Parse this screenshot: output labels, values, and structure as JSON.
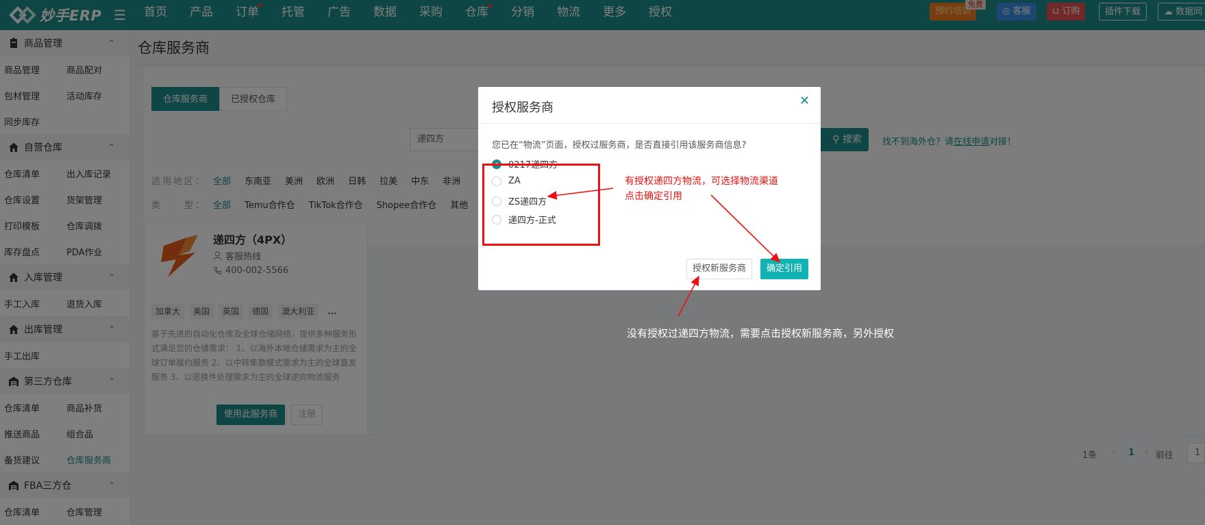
{
  "header": {
    "logo_text": "妙手ERP",
    "nav": [
      {
        "label": "首页",
        "dot": false
      },
      {
        "label": "产品",
        "dot": false
      },
      {
        "label": "订单",
        "dot": true
      },
      {
        "label": "托管",
        "dot": false
      },
      {
        "label": "广告",
        "dot": false
      },
      {
        "label": "数据",
        "dot": false
      },
      {
        "label": "采购",
        "dot": false
      },
      {
        "label": "仓库",
        "dot": true
      },
      {
        "label": "分销",
        "dot": false
      },
      {
        "label": "物流",
        "dot": false
      },
      {
        "label": "更多",
        "dot": false
      },
      {
        "label": "授权",
        "dot": false
      }
    ],
    "training_label": "预约培训",
    "free_badge": "免费",
    "service_label": "客服",
    "order_label": "订购",
    "plugin_label": "插件下载",
    "data_label": "数据同"
  },
  "sidebar": {
    "groups": [
      {
        "title": "商品管理",
        "icon": "clipboard-icon",
        "rows": [
          [
            "商品管理",
            "商品配对"
          ],
          [
            "包材管理",
            "活动库存"
          ],
          [
            "同步库存",
            ""
          ]
        ]
      },
      {
        "title": "自营仓库",
        "icon": "house-icon",
        "rows": [
          [
            "仓库清单",
            "出入库记录"
          ],
          [
            "仓库设置",
            "货架管理"
          ],
          [
            "打印模板",
            "仓库调拨"
          ],
          [
            "库存盘点",
            "PDA作业"
          ]
        ]
      },
      {
        "title": "入库管理",
        "icon": "house-icon",
        "rows": [
          [
            "手工入库",
            "退货入库"
          ]
        ]
      },
      {
        "title": "出库管理",
        "icon": "house-icon",
        "rows": [
          [
            "手工出库",
            ""
          ]
        ]
      },
      {
        "title": "第三方仓库",
        "icon": "warehouse-icon",
        "rows": [
          [
            "仓库清单",
            "商品补货"
          ],
          [
            "推送商品",
            "组合品"
          ],
          [
            "备货建议",
            "仓库服务商"
          ]
        ]
      },
      {
        "title": "FBA三方仓",
        "icon": "warehouse-icon",
        "rows": [
          [
            "仓库清单",
            "仓库管理"
          ]
        ]
      }
    ],
    "active_item": "仓库服务商"
  },
  "main": {
    "page_title": "仓库服务商",
    "tabs": [
      "仓库服务商",
      "已授权仓库"
    ],
    "search_value": "递四方",
    "search_button": "搜索",
    "hint_prefix": "找不到海外仓？请",
    "hint_link": "在线申请",
    "hint_suffix": "对接！",
    "region_label": "适用地区：",
    "regions": [
      "全部",
      "东南亚",
      "美洲",
      "欧洲",
      "日韩",
      "拉美",
      "中东",
      "非洲"
    ],
    "type_label": "类　　型：",
    "types": [
      "全部",
      "Temu合作仓",
      "TikTok合作仓",
      "Shopee合作仓",
      "其他"
    ],
    "provider": {
      "name": "递四方（4PX）",
      "service_label": "客服热线",
      "phone": "400-002-5566",
      "tags": [
        "加拿大",
        "美国",
        "英国",
        "德国",
        "澳大利亚",
        "..."
      ],
      "description": "基于先进的自动化仓库及全球仓储网络，提供多种服务形式满足您的仓储需求： 1、以海外本地仓储需求为主的全球订单履约服务 2、以中转集散模式需求为主的全球直发服务 3、以退换件处理需求为主的全球逆向物流服务",
      "use_button": "使用此服务商",
      "register_button": "注册"
    },
    "pager": {
      "total": "1条",
      "current": "1",
      "goto_label": "前往",
      "goto_value": "1"
    }
  },
  "dialog": {
    "title": "授权服务商",
    "question": "您已在“物流”页面，授权过服务商，是否直接引用该服务商信息?",
    "options": [
      {
        "label": "0217递四方",
        "selected": true
      },
      {
        "label": "ZA",
        "selected": false
      },
      {
        "label": "ZS递四方",
        "selected": false
      },
      {
        "label": "递四方-正式",
        "selected": false
      }
    ],
    "new_button": "授权新服务商",
    "confirm_button": "确定引用"
  },
  "annotations": {
    "right_line1": "有授权递四方物流，可选择物流渠道",
    "right_line2": "点击确定引用",
    "bottom": "没有授权过递四方物流，需要点击授权新服务商，另外授权"
  }
}
